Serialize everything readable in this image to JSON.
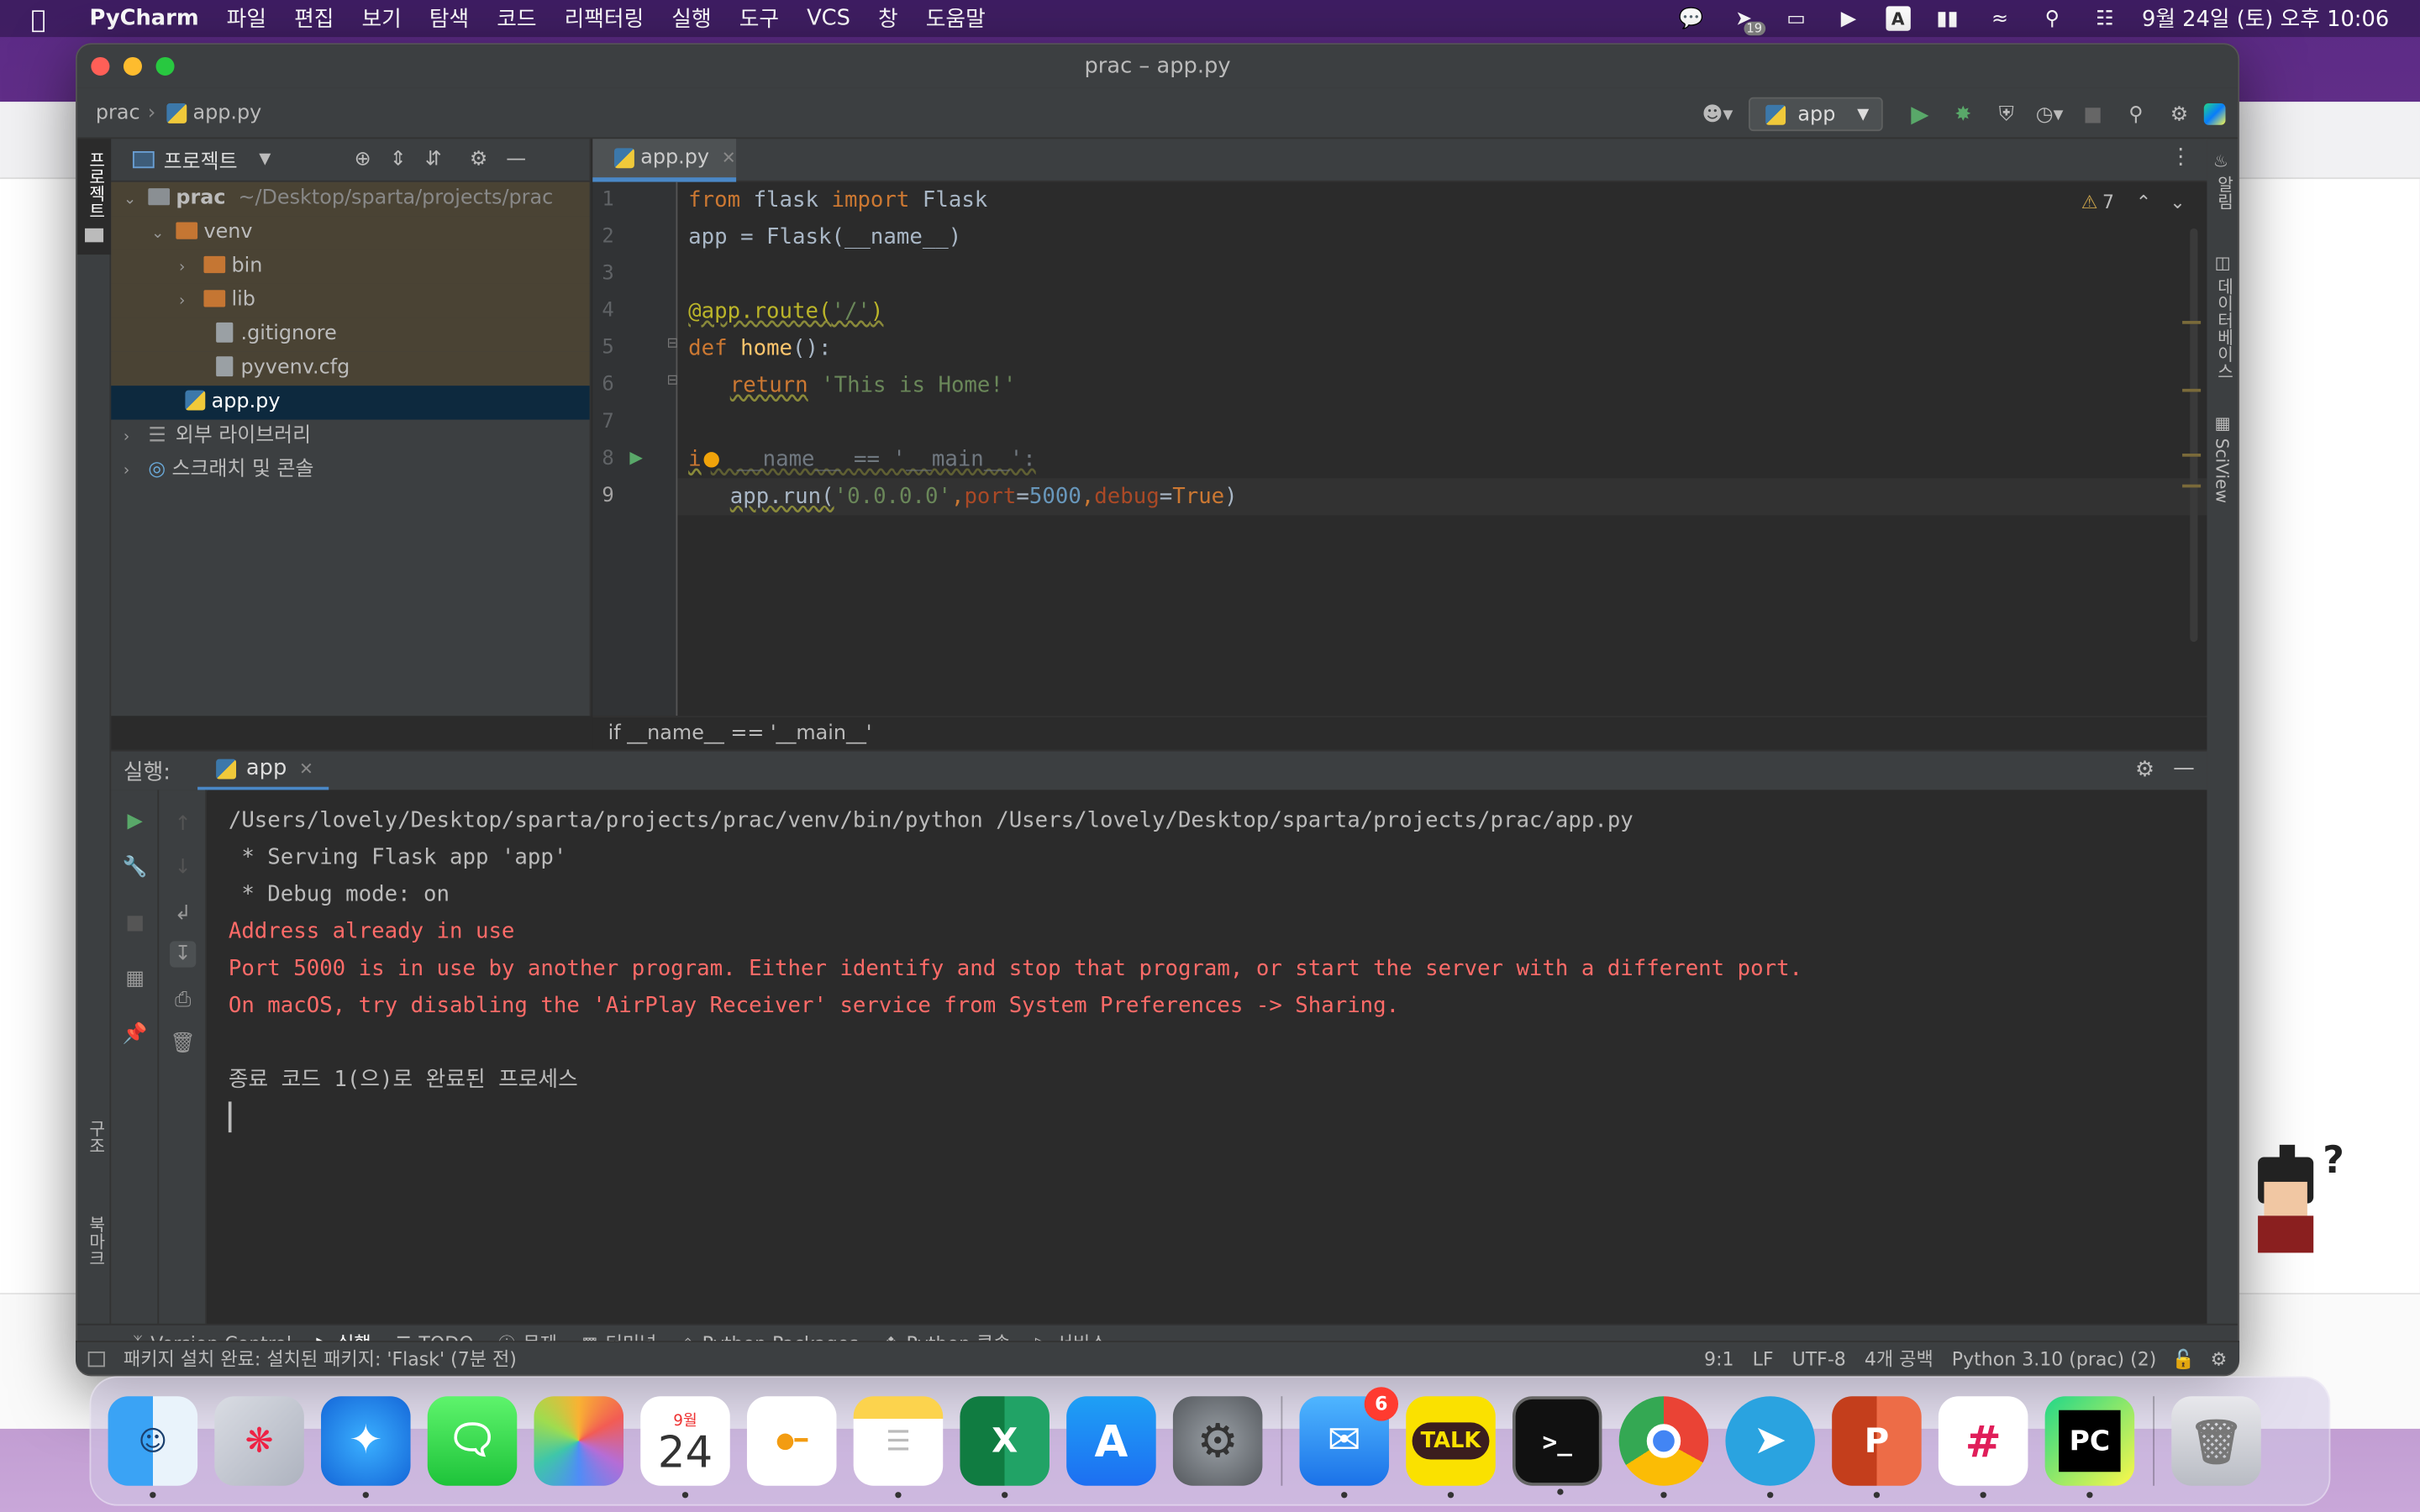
{
  "menubar": {
    "app_name": "PyCharm",
    "items": [
      "파일",
      "편집",
      "보기",
      "탐색",
      "코드",
      "리팩터링",
      "실행",
      "도구",
      "VCS",
      "창",
      "도움말"
    ],
    "clock": "9월 24일 (토) 오후 10:06",
    "tray_badge": "19"
  },
  "window": {
    "title": "prac – app.py"
  },
  "navbar": {
    "project": "prac",
    "file": "app.py",
    "run_config": "app"
  },
  "left_strip": {
    "project_label": "프로젝트",
    "structure_label": "구조",
    "bookmarks_label": "북마크"
  },
  "right_strip": {
    "notifications_label": "알림",
    "database_label": "데이터베이스",
    "sciview_label": "SciView"
  },
  "project_panel": {
    "title": "프로젝트",
    "tree": [
      {
        "label": "prac",
        "suffix": "~/Desktop/sparta/projects/prac"
      },
      {
        "label": "venv"
      },
      {
        "label": "bin"
      },
      {
        "label": "lib"
      },
      {
        "label": ".gitignore"
      },
      {
        "label": "pyvenv.cfg"
      },
      {
        "label": "app.py"
      },
      {
        "label": "외부 라이브러리"
      },
      {
        "label": "스크래치 및 콘솔"
      }
    ]
  },
  "editor": {
    "tab_label": "app.py",
    "warnings_count": "7",
    "line_numbers": [
      "1",
      "2",
      "3",
      "4",
      "5",
      "6",
      "7",
      "8",
      "9"
    ],
    "breadcrumb": "if __name__ == '__main__'",
    "code": {
      "l1_kw1": "from",
      "l1_mod": " flask ",
      "l1_kw2": "import",
      "l1_name": " Flask",
      "l2": "app = Flask(__name__)",
      "l4_dec": "@app.route(",
      "l4_str": "'/'",
      "l4_end": ")",
      "l5_kw": "def",
      "l5_fn": " home",
      "l5_end": "():",
      "l6_kw": "return",
      "l6_str": " 'This is Home!'",
      "l8_kw": "i",
      "l8_rest": "  __name__ == '__main__':",
      "l9_a": "app.run(",
      "l9_str": "'0.0.0.0'",
      "l9_c1": ",",
      "l9_port": "port",
      "l9_eq1": "=",
      "l9_num": "5000",
      "l9_c2": ",",
      "l9_debug": "debug",
      "l9_eq2": "=",
      "l9_true": "True",
      "l9_end": ")"
    }
  },
  "run_panel": {
    "label": "실행:",
    "tab": "app",
    "lines": [
      {
        "text": "/Users/lovely/Desktop/sparta/projects/prac/venv/bin/python /Users/lovely/Desktop/sparta/projects/prac/app.py",
        "error": false
      },
      {
        "text": " * Serving Flask app 'app'",
        "error": false
      },
      {
        "text": " * Debug mode: on",
        "error": false
      },
      {
        "text": "Address already in use",
        "error": true
      },
      {
        "text": "Port 5000 is in use by another program. Either identify and stop that program, or start the server with a different port.",
        "error": true
      },
      {
        "text": "On macOS, try disabling the 'AirPlay Receiver' service from System Preferences -> Sharing.",
        "error": true
      },
      {
        "text": "",
        "error": false
      },
      {
        "text": "종료 코드 1(으)로 완료된 프로세스",
        "error": false
      }
    ]
  },
  "toolwindows": [
    "Version Control",
    "실행",
    "TODO",
    "문제",
    "터미널",
    "Python Packages",
    "Python 콘솔",
    "서비스"
  ],
  "statusbar": {
    "message": "패키지 설치 완료: 설치된 패키지: 'Flask' (7분 전)",
    "position": "9:1",
    "line_sep": "LF",
    "encoding": "UTF-8",
    "indent": "4개 공백",
    "interpreter": "Python 3.10 (prac) (2)"
  },
  "dock": {
    "calendar_month": "9월",
    "calendar_day": "24",
    "mail_badge": "6",
    "kakao_label": "TALK",
    "pycharm_label": "PC"
  }
}
